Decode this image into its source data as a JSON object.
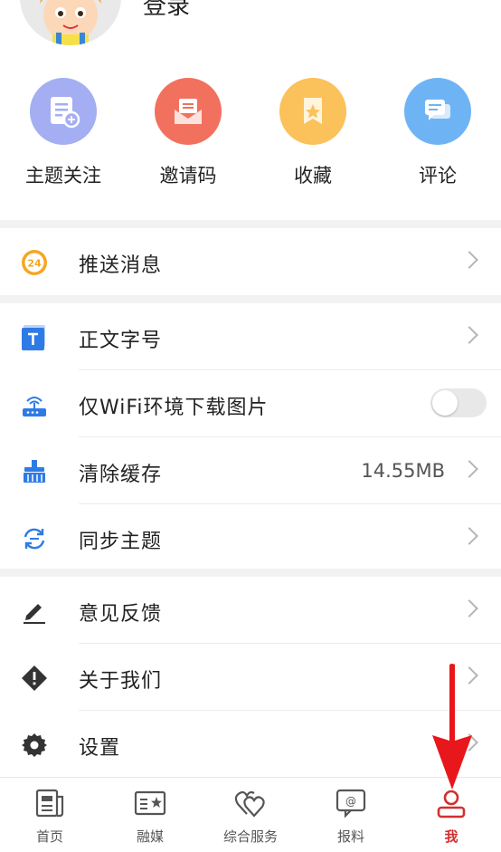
{
  "header": {
    "login_text": "登录"
  },
  "quick_actions": [
    {
      "label": "主题关注",
      "icon": "doc-plus-icon",
      "color": "#9fa8f0"
    },
    {
      "label": "邀请码",
      "icon": "envelope-icon",
      "color": "#f2705e"
    },
    {
      "label": "收藏",
      "icon": "bookmark-star-icon",
      "color": "#fbc15a"
    },
    {
      "label": "评论",
      "icon": "chat-bubble-icon",
      "color": "#6eb4f5"
    }
  ],
  "menu": {
    "push": {
      "label": "推送消息",
      "icon": "clock-24-icon",
      "badge": "24"
    },
    "font_size": {
      "label": "正文字号",
      "icon": "font-t-icon"
    },
    "wifi_only": {
      "label": "仅WiFi环境下载图片",
      "icon": "router-icon",
      "enabled": false
    },
    "clear_cache": {
      "label": "清除缓存",
      "value": "14.55MB",
      "icon": "broom-icon"
    },
    "sync_theme": {
      "label": "同步主题",
      "icon": "sync-icon"
    },
    "feedback": {
      "label": "意见反馈",
      "icon": "pen-icon"
    },
    "about": {
      "label": "关于我们",
      "icon": "diamond-alert-icon"
    },
    "settings": {
      "label": "设置",
      "icon": "gear-icon"
    }
  },
  "bottom_nav": [
    {
      "label": "首页",
      "icon": "newspaper-icon",
      "active": false
    },
    {
      "label": "融媒",
      "icon": "media-card-icon",
      "active": false
    },
    {
      "label": "综合服务",
      "icon": "hearts-icon",
      "active": false
    },
    {
      "label": "报料",
      "icon": "at-chat-icon",
      "active": false
    },
    {
      "label": "我",
      "icon": "user-icon",
      "active": true
    }
  ],
  "colors": {
    "accent_red": "#d32f2f",
    "arrow_red": "#e8171b",
    "orange": "#f5a623",
    "blue": "#3a7be0"
  }
}
